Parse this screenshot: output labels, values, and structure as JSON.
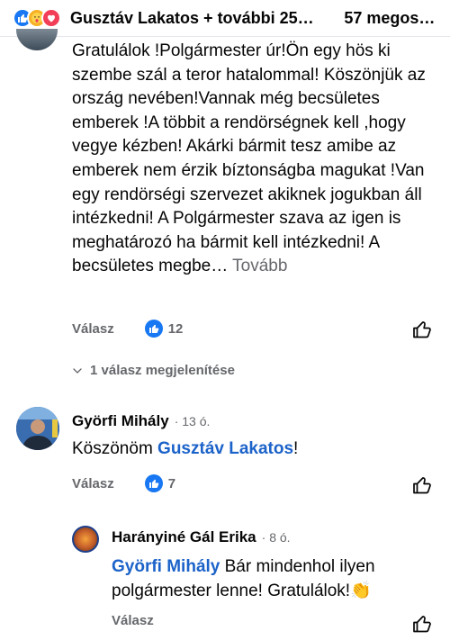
{
  "header": {
    "reacters": "Gusztáv Lakatos + további 25…",
    "shares": "57 megos…",
    "reactions": [
      "like",
      "care",
      "love"
    ]
  },
  "comment1": {
    "text": "Gratulálok !Polgármester úr!Ön egy hös ki szembe szál a teror hatalommal! Köszönjük az ország nevében!Vannak még becsületes emberek !A többit a rendörségnek kell ,hogy vegye kézben! Akárki bármit tesz amibe az emberek nem érzik bíztonságba magukat !Van egy rendörségi szervezet akiknek jogukban áll intézkedni!  A Polgármester szava az igen is meghatározó ha bármit kell intézkedni! A becsületes megbe…",
    "more": "Tovább",
    "reply_label": "Válasz",
    "likes": "12",
    "show_replies": "1 válasz megjelenítése"
  },
  "comment2": {
    "author": "Györfi Mihály",
    "time": "· 13 ó.",
    "text_prefix": "Köszönöm ",
    "mention": "Gusztáv Lakatos",
    "text_suffix": "!",
    "reply_label": "Válasz",
    "likes": "7"
  },
  "reply1": {
    "author": "Harányiné Gál Erika",
    "time": "· 8 ó.",
    "mention": "Györfi Mihály",
    "text": " Bár mindenhol ilyen polgármester lenne! Gratulálok!👏",
    "reply_label": "Válasz"
  },
  "colors": {
    "accent": "#1877f2",
    "mention": "#1b62c9",
    "secondary_text": "#65676b"
  },
  "icons": [
    "like-reaction-icon",
    "care-reaction-icon",
    "love-reaction-icon",
    "thumbs-up-icon",
    "chevron-down-icon"
  ]
}
